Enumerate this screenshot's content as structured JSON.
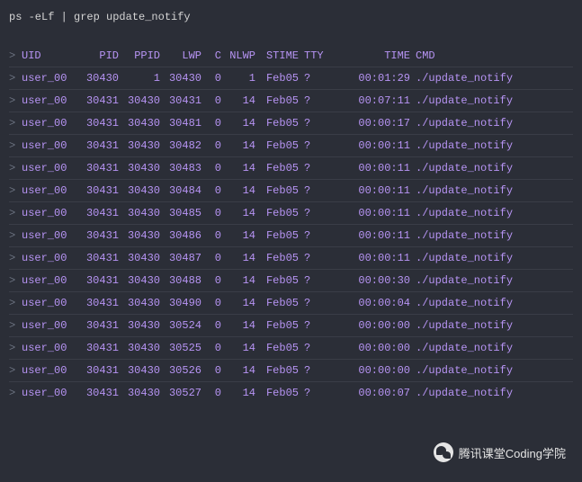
{
  "command": "ps -eLf | grep update_notify",
  "headers": {
    "uid": "UID",
    "pid": "PID",
    "ppid": "PPID",
    "lwp": "LWP",
    "c": "C",
    "nlwp": "NLWP",
    "stime": "STIME",
    "tty": "TTY",
    "time": "TIME",
    "cmd": "CMD"
  },
  "rows": [
    {
      "uid": "user_00",
      "pid": "30430",
      "ppid": "1",
      "lwp": "30430",
      "c": "0",
      "nlwp": "1",
      "stime": "Feb05",
      "tty": "?",
      "time": "00:01:29",
      "cmd": "./update_notify"
    },
    {
      "uid": "user_00",
      "pid": "30431",
      "ppid": "30430",
      "lwp": "30431",
      "c": "0",
      "nlwp": "14",
      "stime": "Feb05",
      "tty": "?",
      "time": "00:07:11",
      "cmd": "./update_notify"
    },
    {
      "uid": "user_00",
      "pid": "30431",
      "ppid": "30430",
      "lwp": "30481",
      "c": "0",
      "nlwp": "14",
      "stime": "Feb05",
      "tty": "?",
      "time": "00:00:17",
      "cmd": "./update_notify"
    },
    {
      "uid": "user_00",
      "pid": "30431",
      "ppid": "30430",
      "lwp": "30482",
      "c": "0",
      "nlwp": "14",
      "stime": "Feb05",
      "tty": "?",
      "time": "00:00:11",
      "cmd": "./update_notify"
    },
    {
      "uid": "user_00",
      "pid": "30431",
      "ppid": "30430",
      "lwp": "30483",
      "c": "0",
      "nlwp": "14",
      "stime": "Feb05",
      "tty": "?",
      "time": "00:00:11",
      "cmd": "./update_notify"
    },
    {
      "uid": "user_00",
      "pid": "30431",
      "ppid": "30430",
      "lwp": "30484",
      "c": "0",
      "nlwp": "14",
      "stime": "Feb05",
      "tty": "?",
      "time": "00:00:11",
      "cmd": "./update_notify"
    },
    {
      "uid": "user_00",
      "pid": "30431",
      "ppid": "30430",
      "lwp": "30485",
      "c": "0",
      "nlwp": "14",
      "stime": "Feb05",
      "tty": "?",
      "time": "00:00:11",
      "cmd": "./update_notify"
    },
    {
      "uid": "user_00",
      "pid": "30431",
      "ppid": "30430",
      "lwp": "30486",
      "c": "0",
      "nlwp": "14",
      "stime": "Feb05",
      "tty": "?",
      "time": "00:00:11",
      "cmd": "./update_notify"
    },
    {
      "uid": "user_00",
      "pid": "30431",
      "ppid": "30430",
      "lwp": "30487",
      "c": "0",
      "nlwp": "14",
      "stime": "Feb05",
      "tty": "?",
      "time": "00:00:11",
      "cmd": "./update_notify"
    },
    {
      "uid": "user_00",
      "pid": "30431",
      "ppid": "30430",
      "lwp": "30488",
      "c": "0",
      "nlwp": "14",
      "stime": "Feb05",
      "tty": "?",
      "time": "00:00:30",
      "cmd": "./update_notify"
    },
    {
      "uid": "user_00",
      "pid": "30431",
      "ppid": "30430",
      "lwp": "30490",
      "c": "0",
      "nlwp": "14",
      "stime": "Feb05",
      "tty": "?",
      "time": "00:00:04",
      "cmd": "./update_notify"
    },
    {
      "uid": "user_00",
      "pid": "30431",
      "ppid": "30430",
      "lwp": "30524",
      "c": "0",
      "nlwp": "14",
      "stime": "Feb05",
      "tty": "?",
      "time": "00:00:00",
      "cmd": "./update_notify"
    },
    {
      "uid": "user_00",
      "pid": "30431",
      "ppid": "30430",
      "lwp": "30525",
      "c": "0",
      "nlwp": "14",
      "stime": "Feb05",
      "tty": "?",
      "time": "00:00:00",
      "cmd": "./update_notify"
    },
    {
      "uid": "user_00",
      "pid": "30431",
      "ppid": "30430",
      "lwp": "30526",
      "c": "0",
      "nlwp": "14",
      "stime": "Feb05",
      "tty": "?",
      "time": "00:00:00",
      "cmd": "./update_notify"
    },
    {
      "uid": "user_00",
      "pid": "30431",
      "ppid": "30430",
      "lwp": "30527",
      "c": "0",
      "nlwp": "14",
      "stime": "Feb05",
      "tty": "?",
      "time": "00:00:07",
      "cmd": "./update_notify"
    }
  ],
  "watermark": "腾讯课堂Coding学院"
}
